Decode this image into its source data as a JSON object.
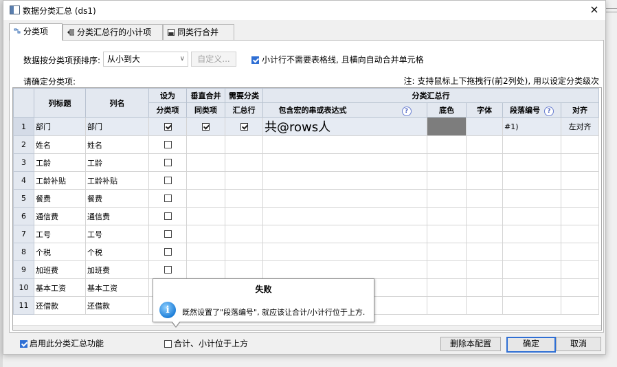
{
  "window": {
    "title": "数据分类汇总 (ds1)",
    "close_symbol": "×"
  },
  "tabs": [
    {
      "label": "分类项",
      "active": true,
      "icon": "tree-icon"
    },
    {
      "label": "分类汇总行的小计项",
      "active": false,
      "icon": "subtotal-icon"
    },
    {
      "label": "同类行合并",
      "active": false,
      "icon": "merge-icon"
    }
  ],
  "sort": {
    "label": "数据按分类项预排序:",
    "value": "从小到大",
    "arrow": "∨",
    "custom_button": "自定义..."
  },
  "option_no_grid": {
    "checked": true,
    "label": "小计行不需要表格线, 且横向自动合并单元格"
  },
  "specify_label": "请确定分类项:",
  "note": "注: 支持鼠标上下拖拽行(前2列处), 用以设定分类级次",
  "grid": {
    "headers": {
      "col_title": "列标题",
      "col_name": "列名",
      "as_category_1": "设为",
      "as_category_2": "分类项",
      "vmerge_1": "垂直合并",
      "vmerge_2": "同类项",
      "need_total_1": "需要分类",
      "need_total_2": "汇总行",
      "group": "分类汇总行",
      "expr": "包含宏的串或表达式",
      "bgcolor": "底色",
      "font": "字体",
      "para_no": "段落编号",
      "align": "对齐",
      "help": "?"
    },
    "rows": [
      {
        "no": "1",
        "title": "部门",
        "name": "部门",
        "cat": true,
        "vmerge": true,
        "total": true,
        "expr": "共@rows人",
        "para": "#1)",
        "align": "左对齐"
      },
      {
        "no": "2",
        "title": "姓名",
        "name": "姓名",
        "cat": false
      },
      {
        "no": "3",
        "title": "工龄",
        "name": "工龄",
        "cat": false
      },
      {
        "no": "4",
        "title": "工龄补贴",
        "name": "工龄补贴",
        "cat": false
      },
      {
        "no": "5",
        "title": "餐费",
        "name": "餐费",
        "cat": false
      },
      {
        "no": "6",
        "title": "通信费",
        "name": "通信费",
        "cat": false
      },
      {
        "no": "7",
        "title": "工号",
        "name": "工号",
        "cat": false
      },
      {
        "no": "8",
        "title": "个税",
        "name": "个税",
        "cat": false
      },
      {
        "no": "9",
        "title": "加班费",
        "name": "加班费",
        "cat": false
      },
      {
        "no": "10",
        "title": "基本工资",
        "name": "基本工资",
        "cat": false
      },
      {
        "no": "11",
        "title": "还借款",
        "name": "还借款",
        "cat": false
      }
    ]
  },
  "popup": {
    "title": "失败",
    "message": "既然设置了\"段落编号\", 就应该让合计/小计行位于上方.",
    "icon_symbol": "i"
  },
  "bottom": {
    "enable_label": "启用此分类汇总功能",
    "enable_checked": true,
    "subtotal_top_label": "合计、小计位于上方",
    "subtotal_top_checked": false,
    "delete_button": "删除本配置",
    "ok_button": "确定",
    "cancel_button": "取消"
  },
  "colors": {
    "accent": "#2f6fd4",
    "header_bg": "#e3e8f0",
    "swatch": "#7d7d7d"
  }
}
